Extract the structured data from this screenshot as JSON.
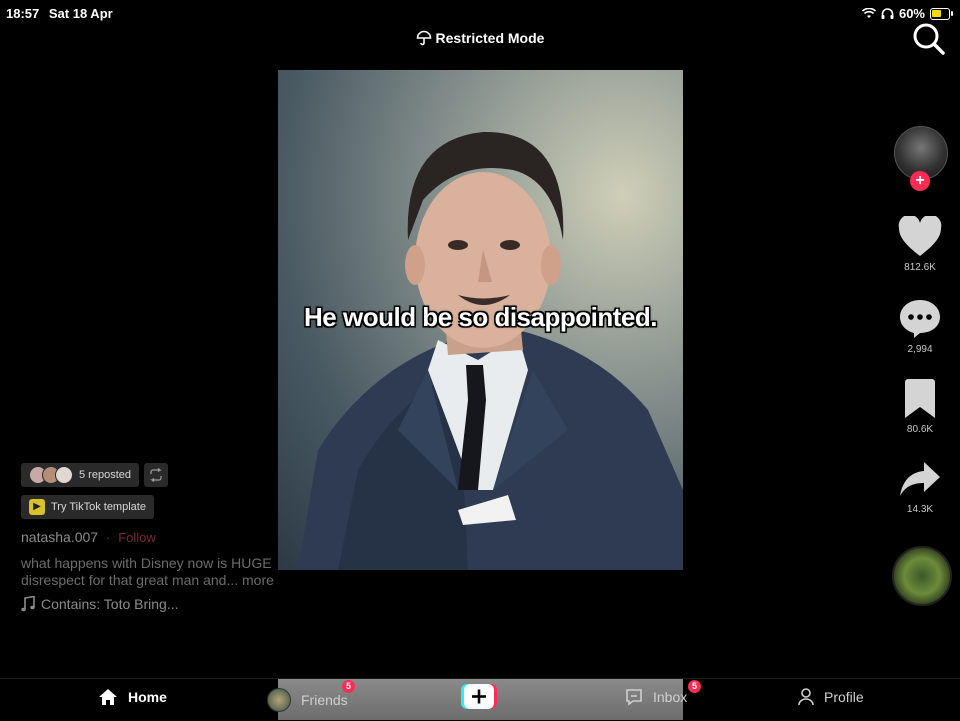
{
  "status_bar": {
    "time": "18:57",
    "date": "Sat 18 Apr",
    "battery": "60%"
  },
  "header": {
    "restricted_mode": "Restricted Mode"
  },
  "video": {
    "caption": "He would be so disappointed."
  },
  "actions": {
    "likes": "812.6K",
    "comments": "2,994",
    "saves": "80.6K",
    "shares": "14.3K"
  },
  "post": {
    "reposted": "5 reposted",
    "template": "Try TikTok template",
    "username": "natasha.007",
    "follow_sep": "·",
    "follow": "Follow",
    "description_line1": "what happens with Disney now is HUGE",
    "description_line2": "disrespect for that great man and... more",
    "sound": "Contains: Toto Bring..."
  },
  "nav": {
    "home": "Home",
    "friends": "Friends",
    "friends_badge": "5",
    "inbox": "Inbox",
    "inbox_badge": "5",
    "profile": "Profile"
  },
  "colors": {
    "accent": "#fe2c55",
    "cyan": "#25f4ee",
    "background": "#000000"
  }
}
